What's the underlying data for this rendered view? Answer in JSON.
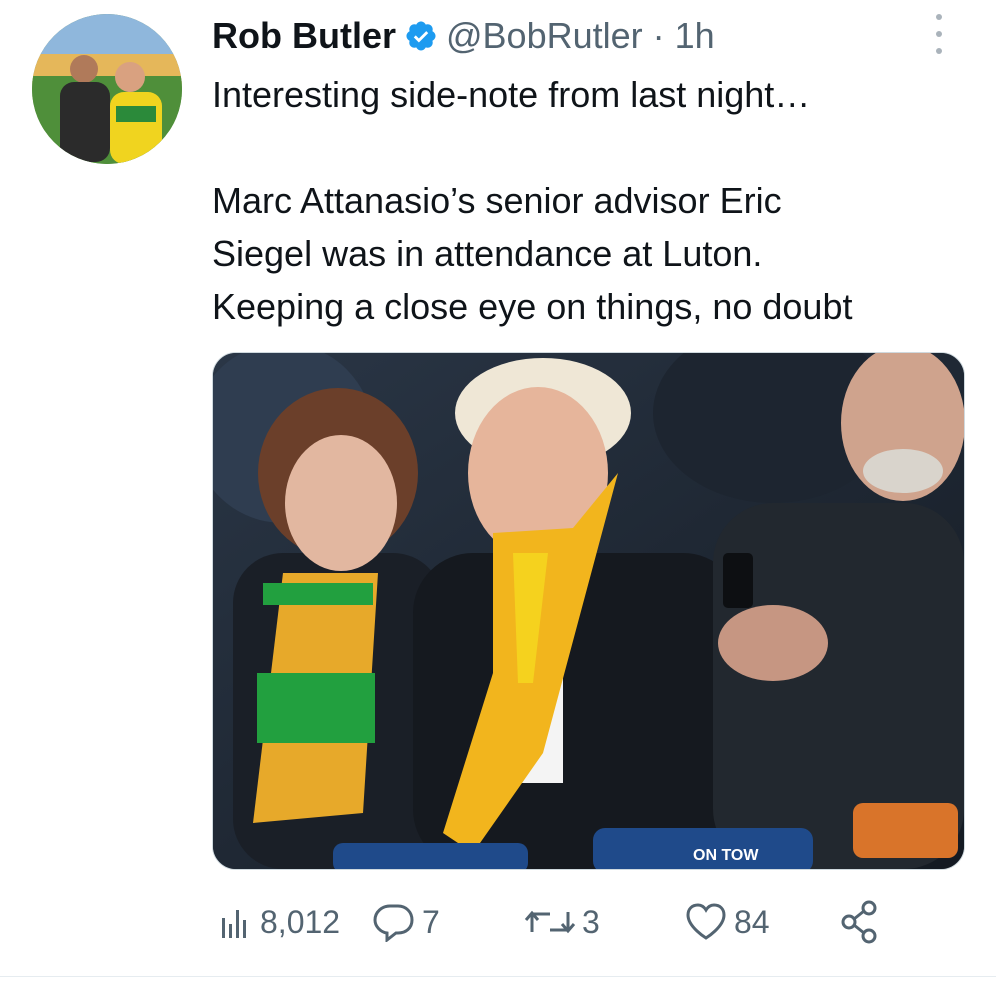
{
  "tweet": {
    "author_name": "Rob Butler",
    "handle": "@BobRutler",
    "separator": "·",
    "time": "1h",
    "text": "Interesting side-note from last night…\n\nMarc Attanasio’s senior advisor Eric\nSiegel was in attendance at Luton.\nKeeping a close eye on things, no doubt",
    "verified": true
  },
  "media": {
    "visible_text": [
      "ON TOW"
    ]
  },
  "actions": {
    "views": "8,012",
    "replies": "7",
    "retweets": "3",
    "likes": "84"
  },
  "icons": {
    "verified": "verified-badge-icon",
    "more": "more-options-icon",
    "views": "views-bar-chart-icon",
    "reply": "reply-bubble-icon",
    "retweet": "retweet-icon",
    "like": "heart-icon",
    "share": "share-icon"
  },
  "colors": {
    "text": "#0f1419",
    "secondary": "#536471",
    "verified_blue": "#1d9bf0",
    "scarf_yellow": "#f2b51d",
    "scarf_green": "#1f9a3a"
  }
}
